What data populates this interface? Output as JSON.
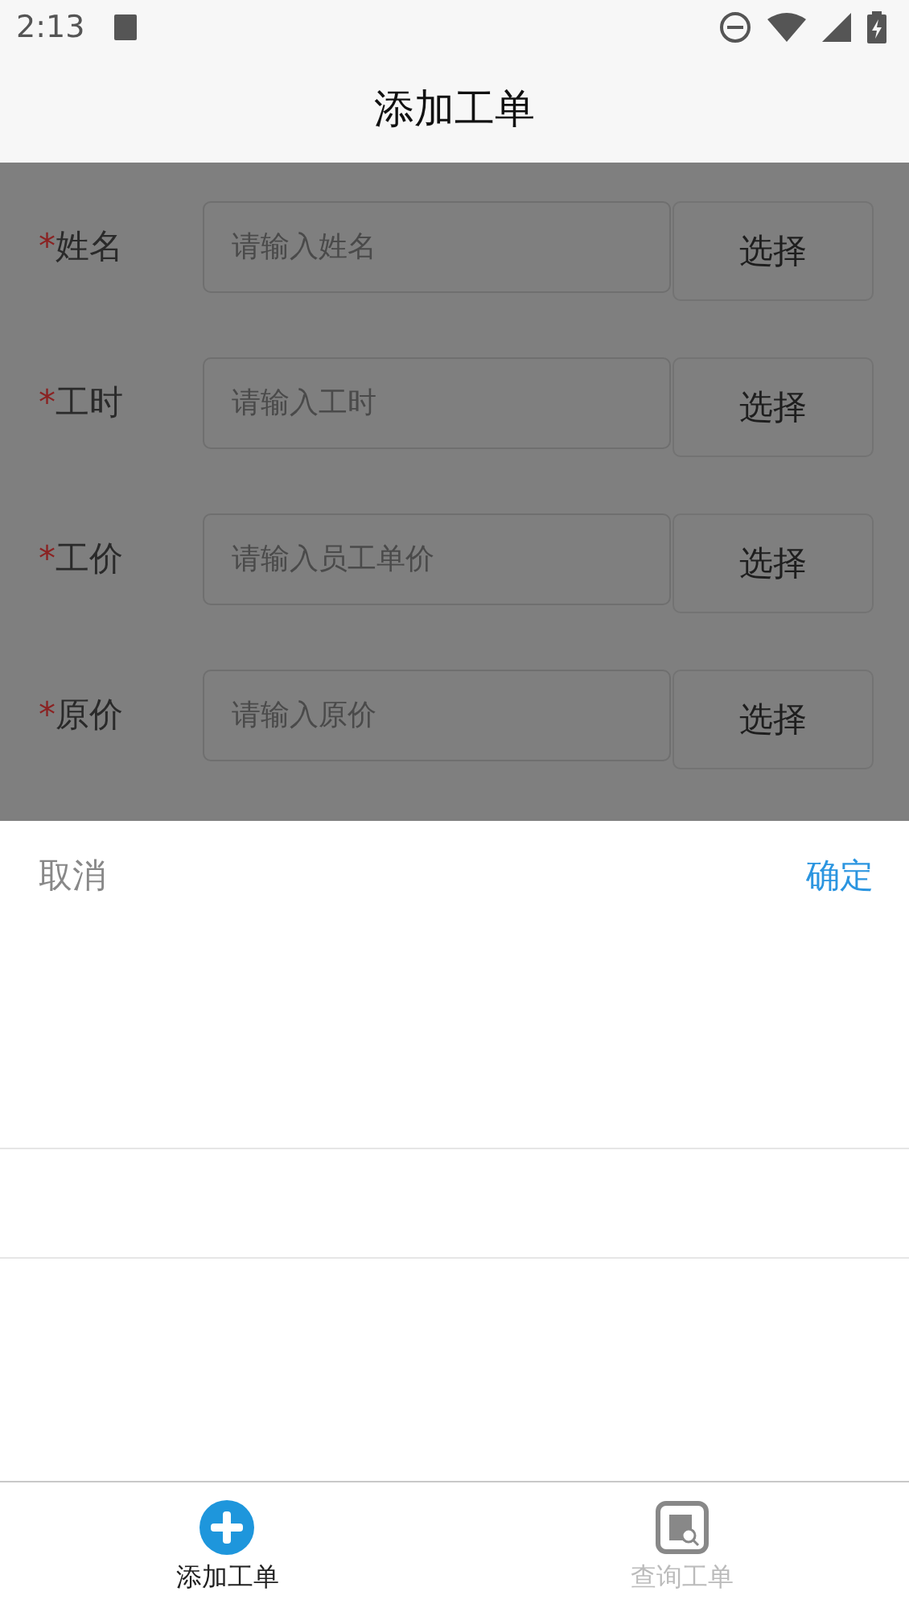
{
  "status_bar": {
    "time": "2:13"
  },
  "header": {
    "title": "添加工单"
  },
  "form": {
    "rows": [
      {
        "required_mark": "*",
        "label": "姓名",
        "placeholder": "请输入姓名",
        "button": "选择"
      },
      {
        "required_mark": "*",
        "label": "工时",
        "placeholder": "请输入工时",
        "button": "选择"
      },
      {
        "required_mark": "*",
        "label": "工价",
        "placeholder": "请输入员工单价",
        "button": "选择"
      },
      {
        "required_mark": "*",
        "label": "原价",
        "placeholder": "请输入原价",
        "button": "选择"
      }
    ]
  },
  "picker": {
    "cancel": "取消",
    "confirm": "确定"
  },
  "tabs": [
    {
      "label": "添加工单",
      "kind": "add",
      "selected": true
    },
    {
      "label": "查询工单",
      "kind": "search",
      "selected": false
    }
  ]
}
